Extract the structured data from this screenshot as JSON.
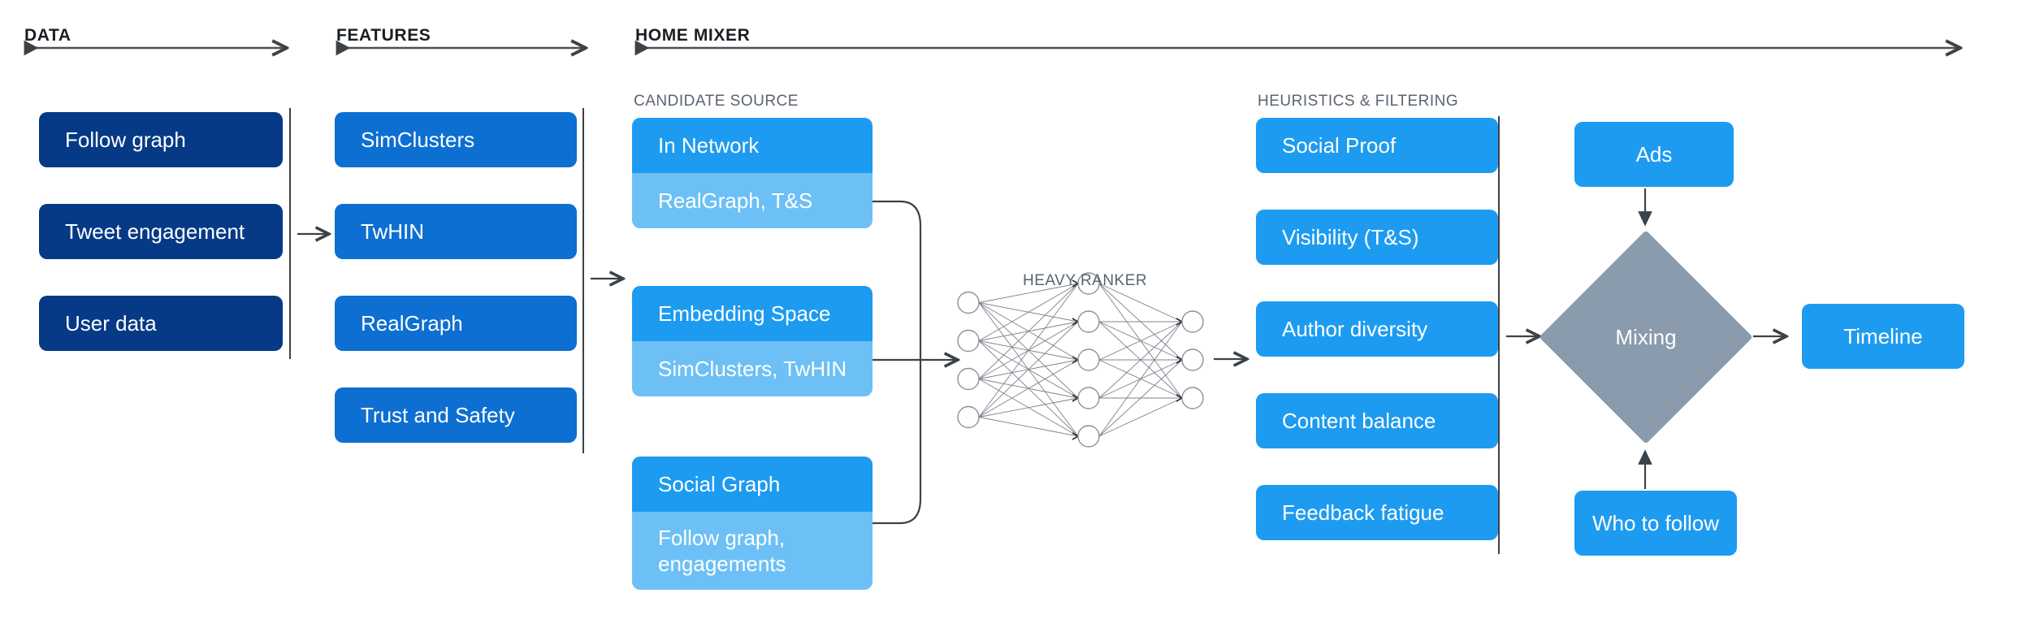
{
  "sections": [
    {
      "label": "DATA"
    },
    {
      "label": "FEATURES"
    },
    {
      "label": "HOME MIXER"
    }
  ],
  "subsections": {
    "candidate_source": "CANDIDATE SOURCE",
    "heuristics": "HEURISTICS & FILTERING"
  },
  "data_column": {
    "items": [
      {
        "label": "Follow graph"
      },
      {
        "label": "Tweet engagement"
      },
      {
        "label": "User data"
      }
    ]
  },
  "features_column": {
    "items": [
      {
        "label": "SimClusters"
      },
      {
        "label": "TwHIN"
      },
      {
        "label": "RealGraph"
      },
      {
        "label": "Trust and Safety"
      }
    ]
  },
  "candidate_sources": {
    "items": [
      {
        "title": "In Network",
        "subtitle": "RealGraph, T&S"
      },
      {
        "title": "Embedding Space",
        "subtitle": "SimClusters, TwHIN"
      },
      {
        "title": "Social Graph",
        "subtitle": "Follow graph, engagements"
      }
    ]
  },
  "heavy_ranker": {
    "label": "HEAVY RANKER",
    "layers": [
      4,
      5,
      3
    ]
  },
  "heuristics_column": {
    "items": [
      {
        "label": "Social Proof"
      },
      {
        "label": "Visibility (T&S)"
      },
      {
        "label": "Author diversity"
      },
      {
        "label": "Content balance"
      },
      {
        "label": "Feedback fatigue"
      }
    ]
  },
  "mixing_stage": {
    "ads": "Ads",
    "mixing": "Mixing",
    "who_to_follow": "Who to follow",
    "timeline": "Timeline"
  },
  "colors": {
    "data_box": "#063a86",
    "feature_box": "#0d6fd1",
    "accent_blue": "#1d9bf0",
    "light_blue": "#6cc0f5",
    "mixing_gray": "#8a9bad",
    "line": "#4a5058",
    "heading": "#1a1d21",
    "subheading": "#5a6472"
  }
}
